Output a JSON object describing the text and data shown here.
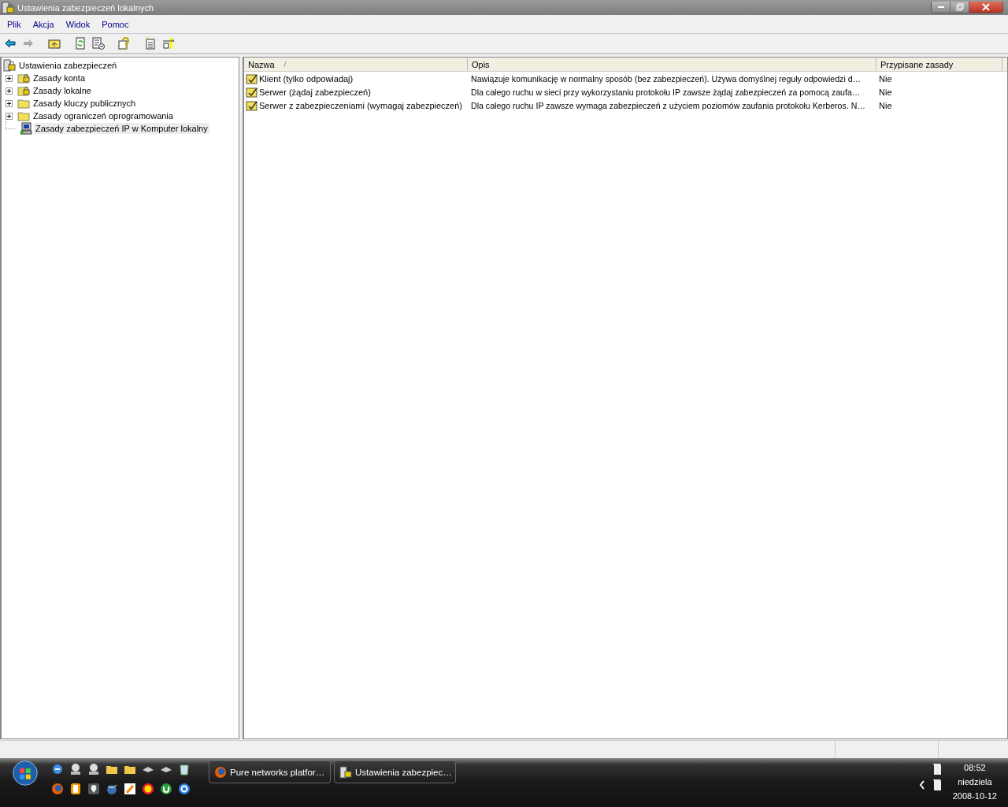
{
  "window": {
    "title": "Ustawienia zabezpieczeń lokalnych"
  },
  "menu": [
    "Plik",
    "Akcja",
    "Widok",
    "Pomoc"
  ],
  "tree": {
    "label": "Ustawienia zabezpieczeń",
    "children": [
      {
        "label": "Zasady konta",
        "kind": "locked-folder",
        "expanded": false,
        "selected": false
      },
      {
        "label": "Zasady lokalne",
        "kind": "locked-folder",
        "expanded": false,
        "selected": false
      },
      {
        "label": "Zasady kluczy publicznych",
        "kind": "folder",
        "expanded": false,
        "selected": false
      },
      {
        "label": "Zasady ograniczeń oprogramowania",
        "kind": "folder",
        "expanded": false,
        "selected": false
      },
      {
        "label": "Zasady zabezpieczeń IP w Komputer lokalny",
        "kind": "computer",
        "selected": true
      }
    ]
  },
  "table": {
    "columns": [
      "Nazwa",
      "Opis",
      "Przypisane zasady"
    ],
    "sort_mark": "/",
    "rows": [
      {
        "name": "Klient (tylko odpowiadaj)",
        "description": "Nawiązuje komunikację w normalny sposób (bez zabezpieczeń). Używa domyślnej reguły odpowiedzi d…",
        "assigned": "Nie"
      },
      {
        "name": "Serwer (żądaj zabezpieczeń)",
        "description": "Dla całego ruchu w sieci przy wykorzystaniu protokołu IP zawsze żądaj zabezpieczeń za pomocą zaufa…",
        "assigned": "Nie"
      },
      {
        "name": "Serwer z zabezpieczeniami (wymagaj zabezpieczeń)",
        "description": "Dla całego ruchu IP zawsze wymaga zabezpieczeń z użyciem poziomów zaufania protokołu Kerberos. N…",
        "assigned": "Nie"
      }
    ]
  },
  "taskbar": {
    "tasks": [
      {
        "label": "Pure networks platfor…",
        "kind": "browser"
      },
      {
        "label": "Ustawienia zabezpiec…",
        "kind": "security"
      }
    ],
    "clock": {
      "time": "08:52",
      "day": "niedziela",
      "date": "2008-10-12"
    }
  }
}
